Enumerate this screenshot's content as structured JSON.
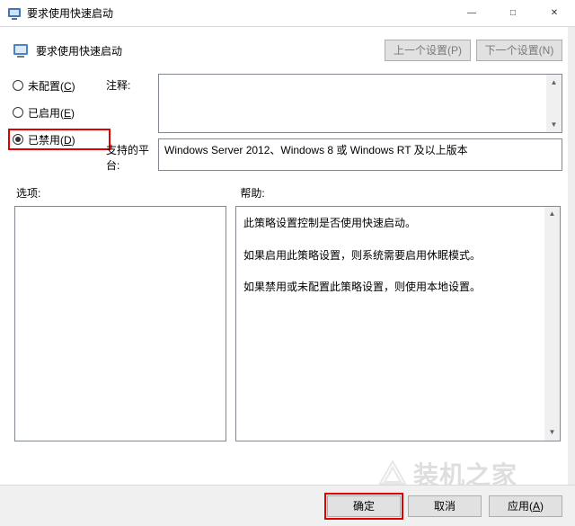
{
  "window": {
    "title": "要求使用快速启动",
    "minimize": "—",
    "maximize": "□",
    "close": "✕"
  },
  "header": {
    "title": "要求使用快速启动",
    "prev": "上一个设置(P)",
    "next": "下一个设置(N)"
  },
  "radios": {
    "not_configured": "未配置(C)",
    "enabled": "已启用(E)",
    "disabled": "已禁用(D)",
    "selected": "disabled"
  },
  "fields": {
    "comment_label": "注释:",
    "comment_value": "",
    "platform_label": "支持的平台:",
    "platform_value": "Windows Server 2012、Windows 8 或 Windows RT 及以上版本"
  },
  "panes": {
    "options_label": "选项:",
    "help_label": "帮助:",
    "help_lines": [
      "此策略设置控制是否使用快速启动。",
      "如果启用此策略设置，则系统需要启用休眠模式。",
      "如果禁用或未配置此策略设置，则使用本地设置。"
    ]
  },
  "footer": {
    "ok": "确定",
    "cancel": "取消",
    "apply": "应用(A)"
  },
  "watermark": "装机之家"
}
